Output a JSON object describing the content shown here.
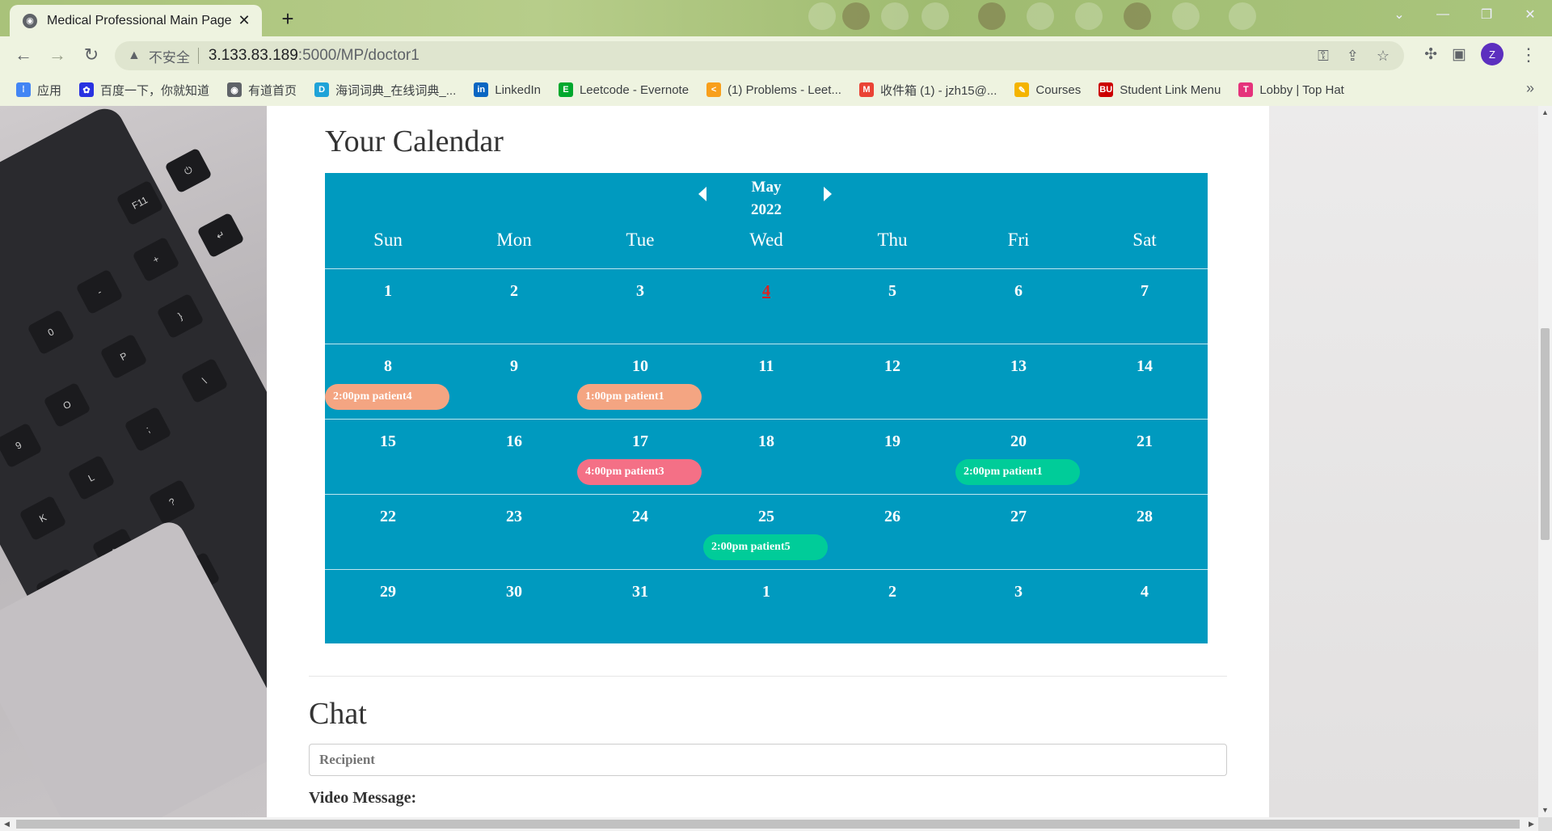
{
  "browser": {
    "tab_title": "Medical Professional Main Page",
    "tab_close": "✕",
    "new_tab": "+",
    "insecure_label": "不安全",
    "url_host": "3.133.83.189",
    "url_path": ":5000/MP/doctor1",
    "avatar_letter": "Z",
    "bookmarks": [
      {
        "label": "应用",
        "icon": "apps-grid-icon",
        "color": "#4285f4",
        "glyph": "⁞"
      },
      {
        "label": "百度一下，你就知道",
        "icon": "baidu-paw-icon",
        "color": "#2932e1",
        "glyph": "✿"
      },
      {
        "label": "有道首页",
        "icon": "globe-icon",
        "color": "#5f6368",
        "glyph": "◉"
      },
      {
        "label": "海词词典_在线词典_...",
        "icon": "dict-d-icon",
        "color": "#1fa3d8",
        "glyph": "D"
      },
      {
        "label": "LinkedIn",
        "icon": "linkedin-icon",
        "color": "#0a66c2",
        "glyph": "in"
      },
      {
        "label": "Leetcode - Evernote",
        "icon": "evernote-icon",
        "color": "#00a82d",
        "glyph": "E"
      },
      {
        "label": "(1) Problems - Leet...",
        "icon": "leetcode-icon",
        "color": "#f89f1b",
        "glyph": "<"
      },
      {
        "label": "收件箱 (1) - jzh15@...",
        "icon": "gmail-icon",
        "color": "#ea4335",
        "glyph": "M"
      },
      {
        "label": "Courses",
        "icon": "courses-pencil-icon",
        "color": "#f4b400",
        "glyph": "✎"
      },
      {
        "label": "Student Link Menu",
        "icon": "bu-icon",
        "color": "#cc0000",
        "glyph": "BU"
      },
      {
        "label": "Lobby | Top Hat",
        "icon": "tophat-icon",
        "color": "#e5337b",
        "glyph": "T"
      }
    ]
  },
  "page": {
    "calendar_title": "Your Calendar",
    "month": "May",
    "year": "2022",
    "weekdays": [
      "Sun",
      "Mon",
      "Tue",
      "Wed",
      "Thu",
      "Fri",
      "Sat"
    ],
    "weeks": [
      [
        "1",
        "2",
        "3",
        "4",
        "5",
        "6",
        "7"
      ],
      [
        "8",
        "9",
        "10",
        "11",
        "12",
        "13",
        "14"
      ],
      [
        "15",
        "16",
        "17",
        "18",
        "19",
        "20",
        "21"
      ],
      [
        "22",
        "23",
        "24",
        "25",
        "26",
        "27",
        "28"
      ],
      [
        "29",
        "30",
        "31",
        "1",
        "2",
        "3",
        "4"
      ]
    ],
    "today": {
      "week": 0,
      "day": 3
    },
    "events": [
      {
        "week": 1,
        "day": 0,
        "label": "2:00pm patient4",
        "color": "#f4a582"
      },
      {
        "week": 1,
        "day": 2,
        "label": "1:00pm patient1",
        "color": "#f4a582"
      },
      {
        "week": 2,
        "day": 2,
        "label": "4:00pm patient3",
        "color": "#f47086"
      },
      {
        "week": 2,
        "day": 5,
        "label": "2:00pm patient1",
        "color": "#00cc99"
      },
      {
        "week": 3,
        "day": 3,
        "label": "2:00pm patient5",
        "color": "#00cc99"
      }
    ],
    "calendar_color": "#009abf",
    "chat_title": "Chat",
    "recipient_placeholder": "Recipient",
    "video_label": "Video Message:"
  }
}
